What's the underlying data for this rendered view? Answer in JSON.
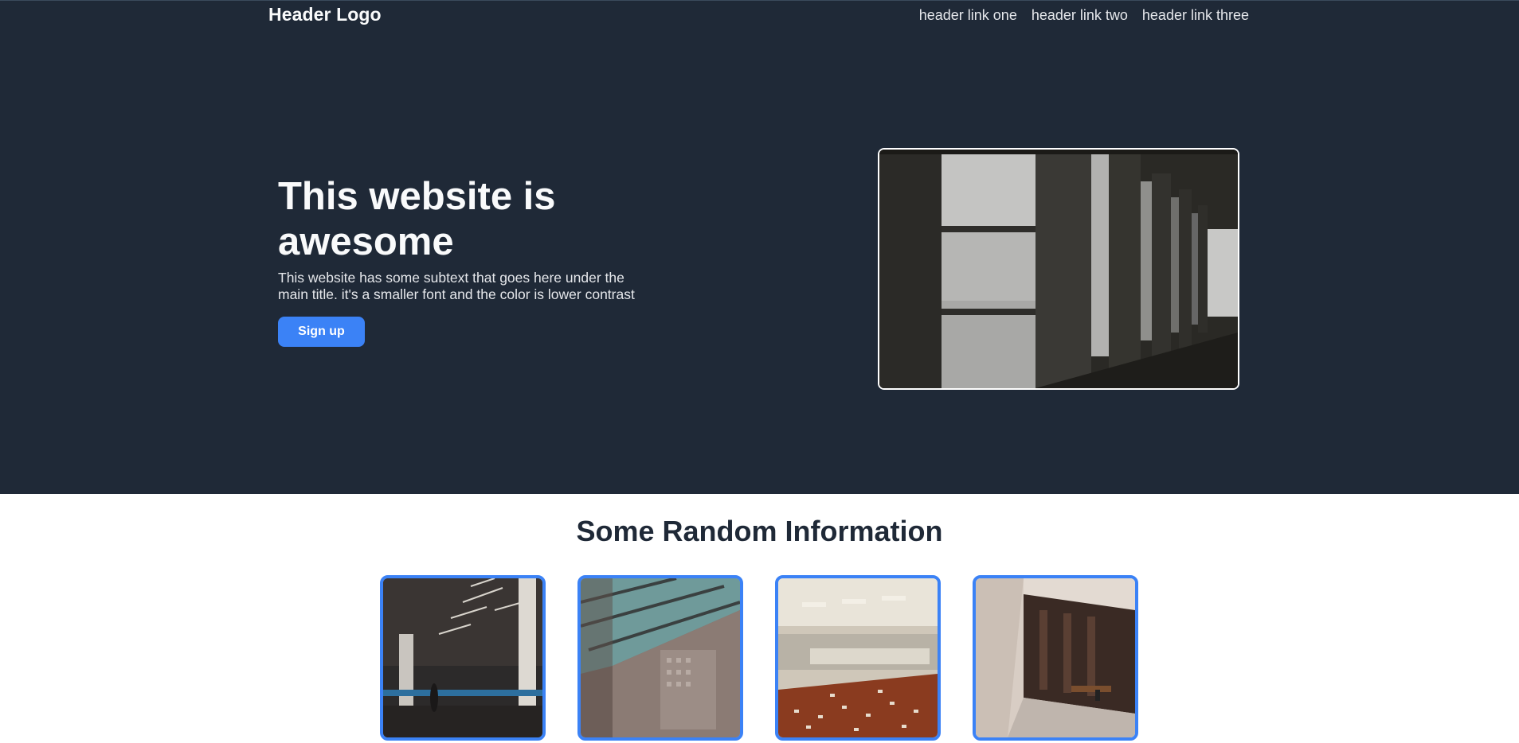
{
  "header": {
    "logo": "Header Logo",
    "links": [
      "header link one",
      "header link two",
      "header link three"
    ]
  },
  "hero": {
    "title": "This website is awesome",
    "subtext": "This website has some subtext that goes here under the main title. it's a smaller font and the color is lower contrast",
    "button_label": "Sign up",
    "image_name": "concrete-hallway-photo"
  },
  "info": {
    "title": "Some Random Information",
    "cards": [
      {
        "image_name": "mall-atrium-photo"
      },
      {
        "image_name": "skylight-corridor-photo"
      },
      {
        "image_name": "curved-tiled-hallway-photo"
      },
      {
        "image_name": "dark-wood-lobby-photo"
      }
    ]
  },
  "colors": {
    "hero_background": "#1f2937",
    "accent": "#3b82f6",
    "heading_dark": "#1f2937"
  }
}
